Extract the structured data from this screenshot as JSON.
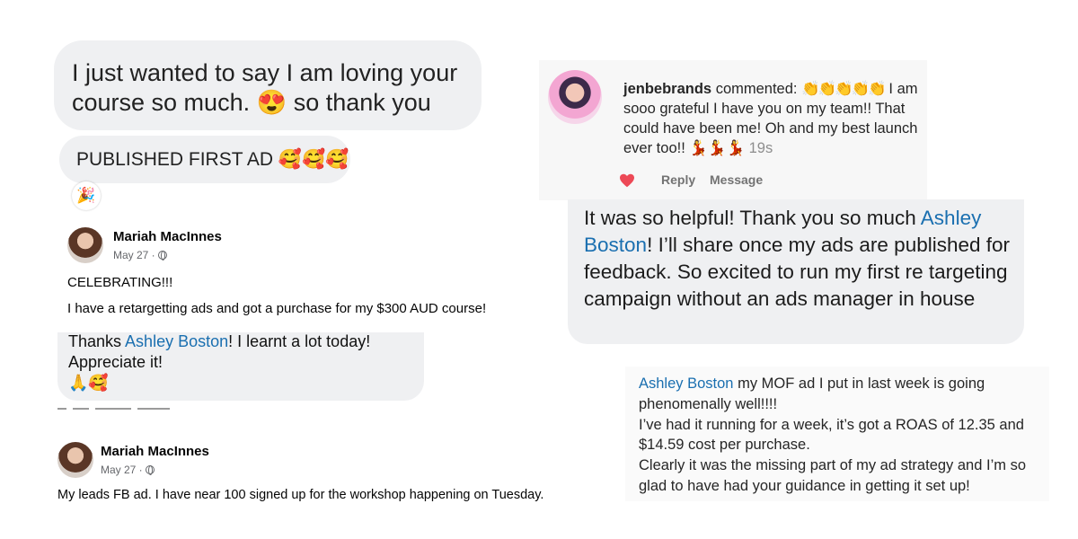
{
  "bubble1": {
    "text": "I just wanted to say I am loving your course so much. 😍 so thank you"
  },
  "bubble2": {
    "text": "PUBLISHED FIRST AD 🥰🥰🥰",
    "reaction": "🎉"
  },
  "post1": {
    "author": "Mariah MacInnes",
    "date": "May 27 ·",
    "line1": "CELEBRATING!!!",
    "line2": "I have a retargetting ads and got a purchase for my $300 AUD course!"
  },
  "thanks": {
    "prefix": "Thanks ",
    "mention": "Ashley Boston",
    "rest": "! I learnt a lot today!",
    "line2": "Appreciate it!",
    "emoji": "🙏🥰"
  },
  "post2": {
    "author": "Mariah MacInnes",
    "date": "May 27 ·",
    "text": "My leads FB ad. I have near 100 signed up for the workshop happening on Tuesday."
  },
  "ig_comment": {
    "username": "jenbebrands",
    "action": "commented:",
    "hands": "👏👏👏👏👏",
    "text": "I am sooo grateful I have you on my team!! That could have been me! Oh and my best launch ever too!! 💃💃💃",
    "time": "19s",
    "reply_label": "Reply",
    "message_label": "Message",
    "heart_color": "#ed4956"
  },
  "helpful": {
    "prefix": "It was so helpful! Thank you so much ",
    "mention": "Ashley Boston",
    "rest": "! I’ll share once my ads are published for feedback. So excited to run my first re targeting campaign without an ads manager in house"
  },
  "mof": {
    "mention": "Ashley Boston",
    "line1_rest": " my MOF ad I put in last week is going phenomenally well!!!!",
    "line2": "I’ve had it running for a week, it’s got a ROAS of 12.35 and $14.59 cost per purchase.",
    "line3": "Clearly it was the missing part of my ad strategy and I’m so glad to have had your guidance in getting it set up!"
  },
  "colors": {
    "mention": "#1a6fb0",
    "bubble": "#eff0f2"
  }
}
